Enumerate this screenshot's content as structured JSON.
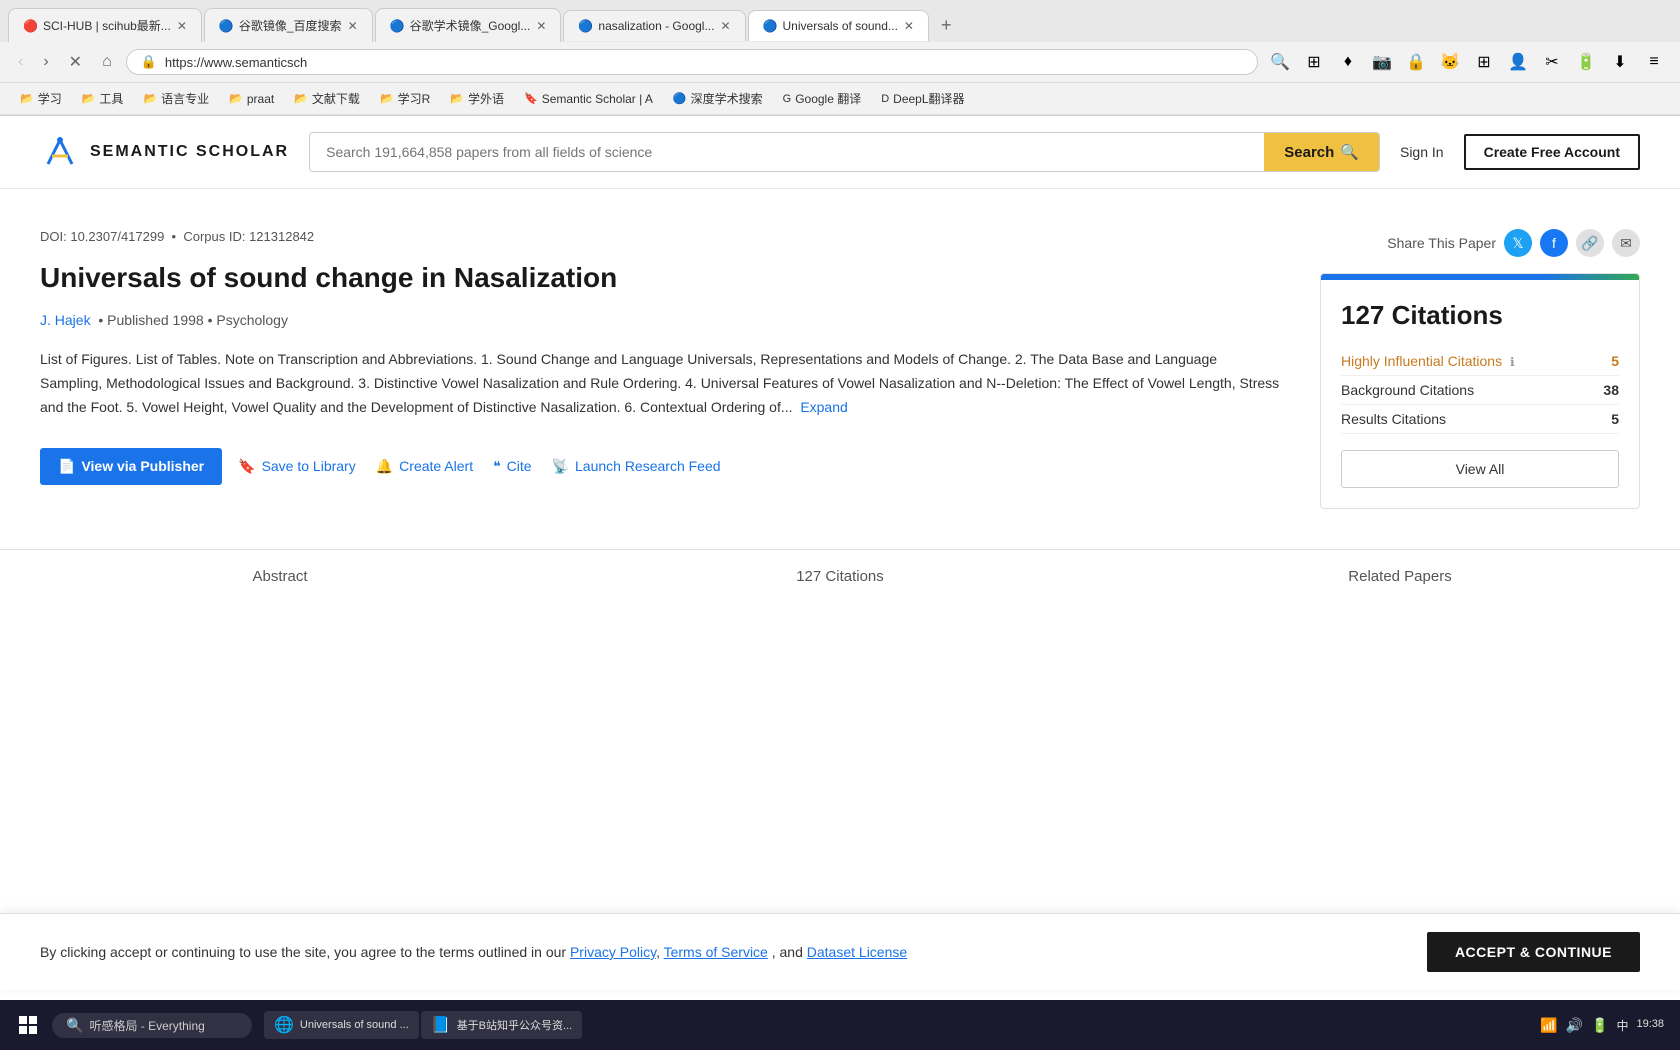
{
  "browser": {
    "tabs": [
      {
        "id": "tab1",
        "favicon": "🔴",
        "title": "SCI-HUB | scihub最新...",
        "active": false
      },
      {
        "id": "tab2",
        "favicon": "🔵",
        "title": "谷歌镜像_百度搜索",
        "active": false
      },
      {
        "id": "tab3",
        "favicon": "🔵",
        "title": "谷歌学术镜像_Googl...",
        "active": false
      },
      {
        "id": "tab4",
        "favicon": "🔵",
        "title": "nasalization - Googl...",
        "active": false
      },
      {
        "id": "tab5",
        "favicon": "🔵",
        "title": "Universals of sound...",
        "active": true
      }
    ],
    "address": "https://www.semanticsch",
    "address_favicon": "谷歌镜像",
    "extensions": [
      "⊞",
      "♦",
      "◉",
      "📷",
      "🔒",
      "✂"
    ]
  },
  "bookmarks": [
    {
      "icon": "📂",
      "label": "学习"
    },
    {
      "icon": "📂",
      "label": "工具"
    },
    {
      "icon": "📂",
      "label": "语言专业"
    },
    {
      "icon": "📂",
      "label": "praat"
    },
    {
      "icon": "📂",
      "label": "文献下载"
    },
    {
      "icon": "📂",
      "label": "学习R"
    },
    {
      "icon": "📂",
      "label": "学外语"
    },
    {
      "icon": "🔖",
      "label": "Semantic Scholar | A"
    },
    {
      "icon": "🔵",
      "label": "深度学术搜索"
    },
    {
      "icon": "G",
      "label": "Google 翻译"
    },
    {
      "icon": "D",
      "label": "DeepL翻译器"
    }
  ],
  "header": {
    "logo_text": "SEMANTIC SCHOLAR",
    "search_placeholder": "Search 191,664,858 papers from all fields of science",
    "search_button": "Search",
    "signin": "Sign In",
    "create_account": "Create Free Account"
  },
  "paper": {
    "doi": "DOI: 10.2307/417299",
    "corpus_id": "Corpus ID: 121312842",
    "title": "Universals of sound change in Nasalization",
    "author": "J. Hajek",
    "published": "Published 1998",
    "field": "Psychology",
    "abstract": "List of Figures. List of Tables. Note on Transcription and Abbreviations. 1. Sound Change and Language Universals, Representations and Models of Change. 2. The Data Base and Language Sampling, Methodological Issues and Background. 3. Distinctive Vowel Nasalization and Rule Ordering. 4. Universal Features of Vowel Nasalization and N--Deletion: The Effect of Vowel Length, Stress and the Foot. 5. Vowel Height, Vowel Quality and the Development of Distinctive Nasalization. 6. Contextual Ordering of...",
    "expand_label": "Expand",
    "actions": {
      "publisher": "View via Publisher",
      "save": "Save to Library",
      "alert": "Create Alert",
      "cite": "Cite",
      "feed": "Launch Research Feed"
    }
  },
  "share": {
    "label": "Share This Paper"
  },
  "citations": {
    "total": "127 Citations",
    "rows": [
      {
        "label": "Highly Influential Citations",
        "count": "5",
        "influential": true
      },
      {
        "label": "Background Citations",
        "count": "38",
        "influential": false
      },
      {
        "label": "Results Citations",
        "count": "5",
        "influential": false
      }
    ],
    "view_all": "View All"
  },
  "tabs": [
    {
      "label": "Abstract",
      "active": false
    },
    {
      "label": "127 Citations",
      "active": false
    },
    {
      "label": "Related Papers",
      "active": false
    }
  ],
  "cookie": {
    "text": "By clicking accept or continuing to use the site, you agree to the terms outlined in our",
    "privacy_policy": "Privacy Policy",
    "terms": "Terms of Service",
    "and": ", and",
    "dataset": "Dataset License",
    "accept": "ACCEPT & CONTINUE"
  },
  "taskbar": {
    "search_placeholder": "听感格局 - Everything",
    "apps": [
      {
        "icon": "🌐",
        "label": "Universals of sound ..."
      },
      {
        "icon": "📘",
        "label": "基于B站知乎公众号资..."
      }
    ],
    "time": "19:38",
    "date": "",
    "lang": "中"
  }
}
